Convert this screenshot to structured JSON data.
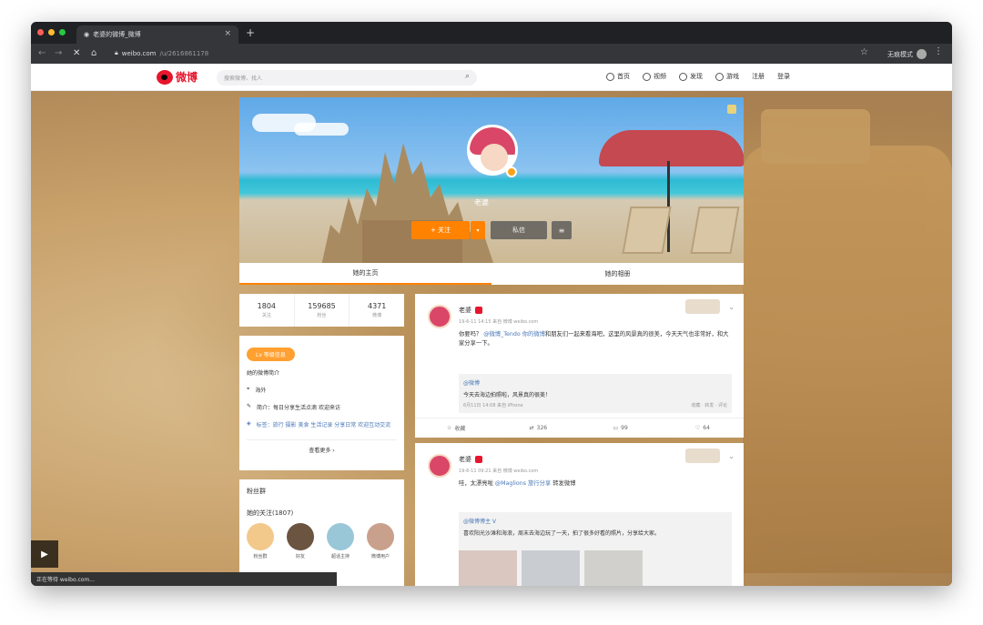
{
  "browser": {
    "tab_title": "老婆的微博_微博",
    "url_host": "weibo.com",
    "url_path": "/u/2616861178",
    "profile_label": "无痕模式"
  },
  "nav": {
    "logo_text": "微博",
    "search_placeholder": "搜索微博、找人",
    "links": [
      "首页",
      "视频",
      "发现",
      "游戏",
      "注册",
      "登录"
    ]
  },
  "cover": {
    "name": "老婆",
    "follow_label": "+ 关注",
    "more_label": "▾",
    "message_label": "私信",
    "menu_label": "≡"
  },
  "profile_tabs": [
    "她的主页",
    "她的相册"
  ],
  "stats": [
    {
      "num": "1804",
      "label": "关注"
    },
    {
      "num": "159685",
      "label": "粉丝"
    },
    {
      "num": "4371",
      "label": "微博"
    }
  ],
  "info": {
    "pill": "Lv 等级信息",
    "desc": "她的微博简介",
    "rows": [
      "海外",
      "简介：每日分享生活点滴 欢迎来访",
      "标签：旅行 摄影 美食 生活记录 分享日常 欢迎互动交流"
    ],
    "more": "查看更多 ›"
  },
  "fans": {
    "title": "粉丝群",
    "subtitle": "她的关注(1807)",
    "people": [
      "粉丝群",
      "好友",
      "超话主持",
      "微博用户"
    ]
  },
  "posts": [
    {
      "name": "老婆",
      "meta": "19-6-11 14:15 来自 微博 weibo.com",
      "text_pre": "你要吗？",
      "text_link": "@微博_Tendo 你的微博",
      "text_post": "和朋友们一起来看海吧，这里的风景真的很美，今天天气也非常好，和大家分享一下。",
      "repost_title": "@微博",
      "repost_body": "今天去海边拍照啦，风景真的很美！",
      "repost_meta": "6月11日 14:08 来自 iPhone",
      "repost_stats": [
        "收藏",
        "转发",
        "评论"
      ],
      "actions": [
        "收藏",
        "326",
        "99",
        "64"
      ]
    },
    {
      "name": "老婆",
      "meta": "19-6-11 09:21 来自 微博 weibo.com",
      "text_pre": "哇，太漂亮啦",
      "text_link": "@Maglions 旅行分享",
      "text_post": "转发微博",
      "repost_title": "@微博博主 V",
      "repost_body": "喜欢阳光沙滩和海浪，周末去海边玩了一天，拍了很多好看的照片，分享给大家。",
      "actions": []
    }
  ],
  "statusbar": "正在等待 weibo.com...",
  "colors": {
    "brand": "#e6162d",
    "accent": "#ff8200",
    "link": "#4a78b8"
  }
}
